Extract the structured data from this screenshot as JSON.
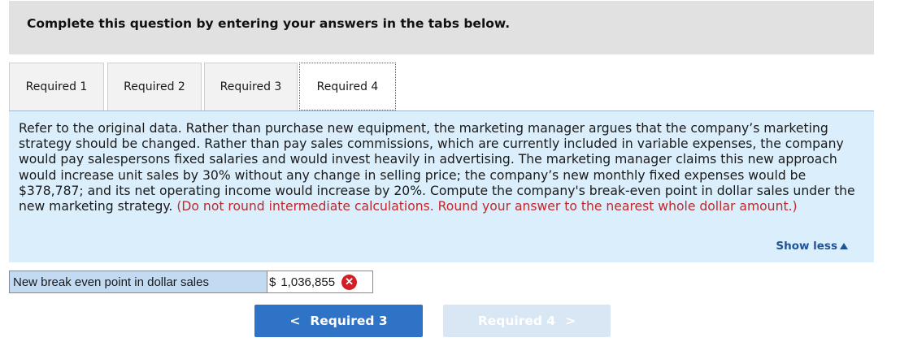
{
  "header": {
    "title": "Complete this question by entering your answers in the tabs below."
  },
  "tabs": [
    {
      "label": "Required 1",
      "active": false
    },
    {
      "label": "Required 2",
      "active": false
    },
    {
      "label": "Required 3",
      "active": false
    },
    {
      "label": "Required 4",
      "active": true
    }
  ],
  "question": {
    "text": "Refer to the original data. Rather than purchase new equipment, the marketing manager argues that the company’s marketing strategy should be changed. Rather than pay sales commissions, which are currently included in variable expenses, the company would pay salespersons fixed salaries and would invest heavily in advertising. The marketing manager claims this new approach would increase unit sales by 30% without any change in selling price; the company’s new monthly fixed expenses would be $378,787; and its net operating income would increase by 20%. Compute the company's break-even point in dollar sales under the new marketing strategy.",
    "note": "(Do not round intermediate calculations. Round your answer to the nearest whole dollar amount.)",
    "show_less": "Show less"
  },
  "answer": {
    "label": "New break even point in dollar sales",
    "currency": "$",
    "value": "1,036,855",
    "status": "incorrect"
  },
  "nav": {
    "prev_label": "Required 3",
    "next_label": "Required 4",
    "prev_glyph": "<",
    "next_glyph": ">"
  },
  "colors": {
    "header_bg": "#e1e1e1",
    "panel_bg": "#dbeefb",
    "note_red": "#c0282a",
    "link_blue": "#1f5497",
    "prev_button": "#2f73c6",
    "next_button_disabled": "#d9e6f4",
    "error_red": "#d21f26"
  }
}
